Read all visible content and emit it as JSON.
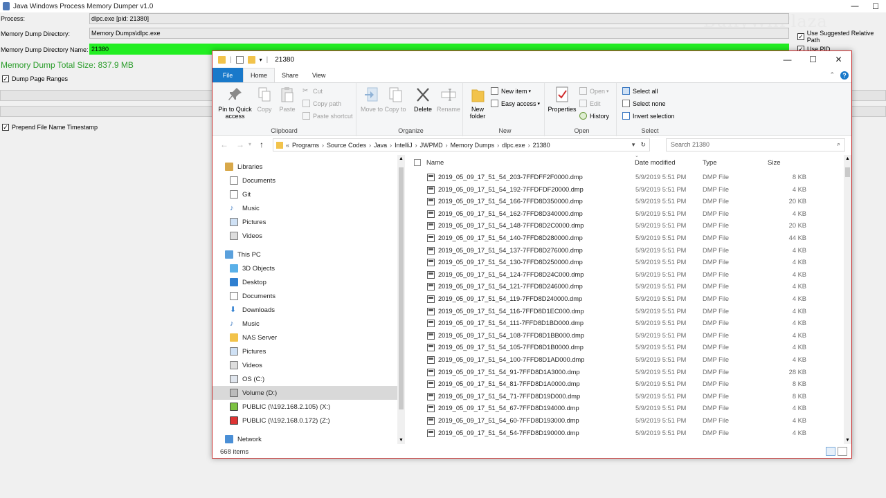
{
  "java_app": {
    "title": "Java Windows Process Memory Dumper v1.0",
    "window_controls": [
      "—",
      "☐"
    ],
    "process_label": "Process:",
    "process_value": "dlpc.exe [pid: 21380]",
    "dump_dir_label": "Memory Dump Directory:",
    "dump_dir_value": "Memory Dumps\\dlpc.exe",
    "use_suggested_label": "Use Suggested Relative Path",
    "dump_dir_name_label": "Memory Dump Directory Name:",
    "dump_dir_name_value": "21380",
    "use_pid_label": "Use PID",
    "total_size": "Memory Dump Total Size: 837.9 MB",
    "dump_page_ranges_label": "Dump Page Ranges",
    "prepend_timestamp_label": "Prepend File Name Timestamp",
    "watermark": "BullyWiiPlaza",
    "accent_color": "#22ee22"
  },
  "explorer": {
    "title": "21380",
    "window_controls": [
      "—",
      "☐",
      "✕"
    ],
    "tabs": {
      "file": "File",
      "home": "Home",
      "share": "Share",
      "view": "View"
    },
    "ribbon": {
      "clipboard": {
        "label": "Clipboard",
        "pin": "Pin to Quick access",
        "copy": "Copy",
        "paste": "Paste",
        "cut": "Cut",
        "copy_path": "Copy path",
        "paste_shortcut": "Paste shortcut"
      },
      "organize": {
        "label": "Organize",
        "move_to": "Move to",
        "copy_to": "Copy to",
        "delete": "Delete",
        "rename": "Rename"
      },
      "new": {
        "label": "New",
        "new_folder": "New folder",
        "new_item": "New item",
        "easy_access": "Easy access"
      },
      "open": {
        "label": "Open",
        "properties": "Properties",
        "open": "Open",
        "edit": "Edit",
        "history": "History"
      },
      "select": {
        "label": "Select",
        "select_all": "Select all",
        "select_none": "Select none",
        "invert_selection": "Invert selection"
      }
    },
    "address": {
      "prefix": "«",
      "crumbs": [
        "Programs",
        "Source Codes",
        "Java",
        "IntelliJ",
        "JWPMD",
        "Memory Dumps",
        "dlpc.exe",
        "21380"
      ]
    },
    "search_placeholder": "Search 21380",
    "nav": {
      "libraries": "Libraries",
      "lib_documents": "Documents",
      "lib_git": "Git",
      "lib_music": "Music",
      "lib_pictures": "Pictures",
      "lib_videos": "Videos",
      "this_pc": "This PC",
      "objects3d": "3D Objects",
      "desktop": "Desktop",
      "documents": "Documents",
      "downloads": "Downloads",
      "music": "Music",
      "nas": "NAS Server",
      "pictures": "Pictures",
      "videos": "Videos",
      "os_c": "OS (C:)",
      "volume_d": "Volume (D:)",
      "public_x": "PUBLIC (\\\\192.168.2.105) (X:)",
      "public_z": "PUBLIC (\\\\192.168.0.172) (Z:)",
      "network": "Network"
    },
    "columns": {
      "name": "Name",
      "date": "Date modified",
      "type": "Type",
      "size": "Size"
    },
    "files": [
      {
        "name": "2019_05_09_17_51_54_203-7FFDFF2F0000.dmp",
        "date": "5/9/2019 5:51 PM",
        "type": "DMP File",
        "size": "8 KB"
      },
      {
        "name": "2019_05_09_17_51_54_192-7FFDFDF20000.dmp",
        "date": "5/9/2019 5:51 PM",
        "type": "DMP File",
        "size": "4 KB"
      },
      {
        "name": "2019_05_09_17_51_54_166-7FFD8D350000.dmp",
        "date": "5/9/2019 5:51 PM",
        "type": "DMP File",
        "size": "20 KB"
      },
      {
        "name": "2019_05_09_17_51_54_162-7FFD8D340000.dmp",
        "date": "5/9/2019 5:51 PM",
        "type": "DMP File",
        "size": "4 KB"
      },
      {
        "name": "2019_05_09_17_51_54_148-7FFD8D2C0000.dmp",
        "date": "5/9/2019 5:51 PM",
        "type": "DMP File",
        "size": "20 KB"
      },
      {
        "name": "2019_05_09_17_51_54_140-7FFD8D280000.dmp",
        "date": "5/9/2019 5:51 PM",
        "type": "DMP File",
        "size": "44 KB"
      },
      {
        "name": "2019_05_09_17_51_54_137-7FFD8D276000.dmp",
        "date": "5/9/2019 5:51 PM",
        "type": "DMP File",
        "size": "4 KB"
      },
      {
        "name": "2019_05_09_17_51_54_130-7FFD8D250000.dmp",
        "date": "5/9/2019 5:51 PM",
        "type": "DMP File",
        "size": "4 KB"
      },
      {
        "name": "2019_05_09_17_51_54_124-7FFD8D24C000.dmp",
        "date": "5/9/2019 5:51 PM",
        "type": "DMP File",
        "size": "4 KB"
      },
      {
        "name": "2019_05_09_17_51_54_121-7FFD8D246000.dmp",
        "date": "5/9/2019 5:51 PM",
        "type": "DMP File",
        "size": "4 KB"
      },
      {
        "name": "2019_05_09_17_51_54_119-7FFD8D240000.dmp",
        "date": "5/9/2019 5:51 PM",
        "type": "DMP File",
        "size": "4 KB"
      },
      {
        "name": "2019_05_09_17_51_54_116-7FFD8D1EC000.dmp",
        "date": "5/9/2019 5:51 PM",
        "type": "DMP File",
        "size": "4 KB"
      },
      {
        "name": "2019_05_09_17_51_54_111-7FFD8D1BD000.dmp",
        "date": "5/9/2019 5:51 PM",
        "type": "DMP File",
        "size": "4 KB"
      },
      {
        "name": "2019_05_09_17_51_54_108-7FFD8D1BB000.dmp",
        "date": "5/9/2019 5:51 PM",
        "type": "DMP File",
        "size": "4 KB"
      },
      {
        "name": "2019_05_09_17_51_54_105-7FFD8D1B0000.dmp",
        "date": "5/9/2019 5:51 PM",
        "type": "DMP File",
        "size": "4 KB"
      },
      {
        "name": "2019_05_09_17_51_54_100-7FFD8D1AD000.dmp",
        "date": "5/9/2019 5:51 PM",
        "type": "DMP File",
        "size": "4 KB"
      },
      {
        "name": "2019_05_09_17_51_54_91-7FFD8D1A3000.dmp",
        "date": "5/9/2019 5:51 PM",
        "type": "DMP File",
        "size": "28 KB"
      },
      {
        "name": "2019_05_09_17_51_54_81-7FFD8D1A0000.dmp",
        "date": "5/9/2019 5:51 PM",
        "type": "DMP File",
        "size": "8 KB"
      },
      {
        "name": "2019_05_09_17_51_54_71-7FFD8D19D000.dmp",
        "date": "5/9/2019 5:51 PM",
        "type": "DMP File",
        "size": "8 KB"
      },
      {
        "name": "2019_05_09_17_51_54_67-7FFD8D194000.dmp",
        "date": "5/9/2019 5:51 PM",
        "type": "DMP File",
        "size": "4 KB"
      },
      {
        "name": "2019_05_09_17_51_54_60-7FFD8D193000.dmp",
        "date": "5/9/2019 5:51 PM",
        "type": "DMP File",
        "size": "4 KB"
      },
      {
        "name": "2019_05_09_17_51_54_54-7FFD8D190000.dmp",
        "date": "5/9/2019 5:51 PM",
        "type": "DMP File",
        "size": "4 KB"
      }
    ],
    "status_items": "668 items"
  }
}
